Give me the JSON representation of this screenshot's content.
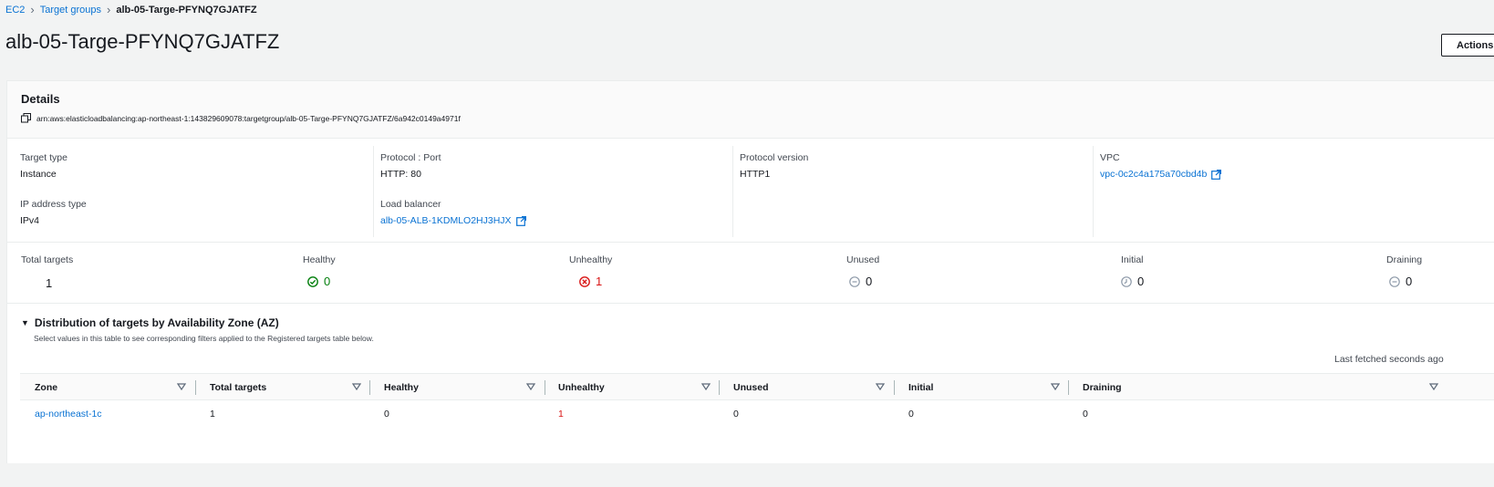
{
  "breadcrumb": {
    "items": [
      "EC2",
      "Target groups"
    ],
    "current": "alb-05-Targe-PFYNQ7GJATFZ"
  },
  "page": {
    "title": "alb-05-Targe-PFYNQ7GJATFZ",
    "actions_label": "Actions"
  },
  "details": {
    "title": "Details",
    "arn": "arn:aws:elasticloadbalancing:ap-northeast-1:143829609078:targetgroup/alb-05-Targe-PFYNQ7GJATFZ/6a942c0149a4971f",
    "target_type_label": "Target type",
    "target_type": "Instance",
    "ip_type_label": "IP address type",
    "ip_type": "IPv4",
    "protocol_port_label": "Protocol : Port",
    "protocol_port": "HTTP: 80",
    "load_balancer_label": "Load balancer",
    "load_balancer": "alb-05-ALB-1KDMLO2HJ3HJX",
    "protocol_version_label": "Protocol version",
    "protocol_version": "HTTP1",
    "vpc_label": "VPC",
    "vpc": "vpc-0c2c4a175a70cbd4b"
  },
  "stats": {
    "total_label": "Total targets",
    "total": "1",
    "healthy_label": "Healthy",
    "healthy": "0",
    "unhealthy_label": "Unhealthy",
    "unhealthy": "1",
    "unused_label": "Unused",
    "unused": "0",
    "initial_label": "Initial",
    "initial": "0",
    "draining_label": "Draining",
    "draining": "0"
  },
  "distribution": {
    "title": "Distribution of targets by Availability Zone (AZ)",
    "subtitle": "Select values in this table to see corresponding filters applied to the Registered targets table below.",
    "last_fetched": "Last fetched seconds ago",
    "columns": [
      "Zone",
      "Total targets",
      "Healthy",
      "Unhealthy",
      "Unused",
      "Initial",
      "Draining"
    ],
    "rows": [
      {
        "zone": "ap-northeast-1c",
        "total": "1",
        "healthy": "0",
        "unhealthy": "1",
        "unused": "0",
        "initial": "0",
        "draining": "0"
      }
    ]
  },
  "colors": {
    "link": "#0972d3",
    "healthy": "#037f0c",
    "unhealthy": "#d91515"
  }
}
